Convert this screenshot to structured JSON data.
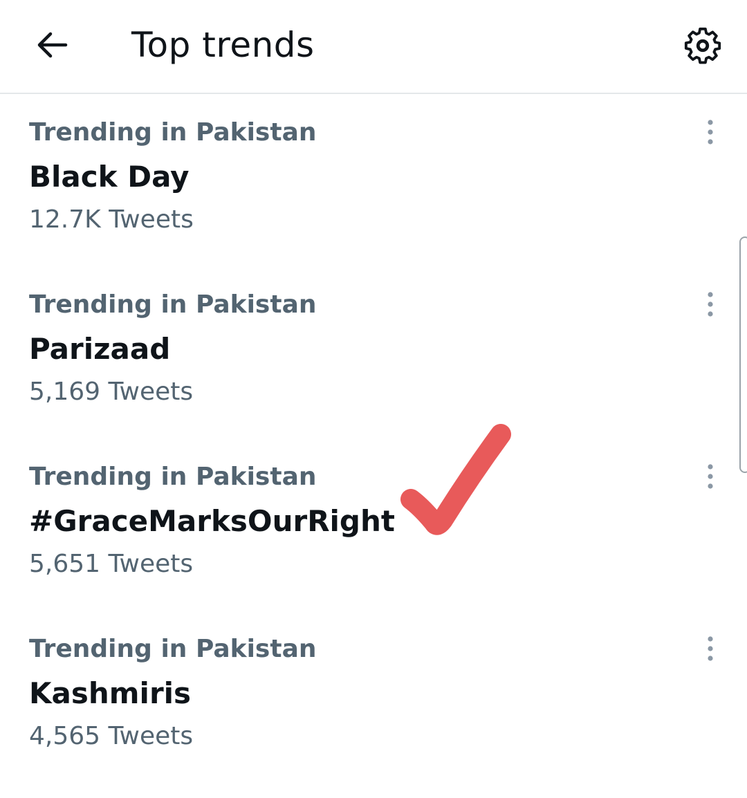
{
  "header": {
    "title": "Top trends",
    "back_icon": "arrow-left-icon",
    "settings_icon": "gear-icon"
  },
  "trends": [
    {
      "context": "Trending in Pakistan",
      "name": "Black Day",
      "count": "12.7K Tweets"
    },
    {
      "context": "Trending in Pakistan",
      "name": "Parizaad",
      "count": "5,169 Tweets"
    },
    {
      "context": "Trending in Pakistan",
      "name": "#GraceMarksOurRight",
      "count": "5,651 Tweets"
    },
    {
      "context": "Trending in Pakistan",
      "name": "Kashmiris",
      "count": "4,565 Tweets"
    }
  ],
  "annotation": {
    "icon": "red-checkmark",
    "color": "#e85a5a"
  },
  "colors": {
    "primary_text": "#0f1419",
    "secondary_text": "#536471",
    "divider": "#e4e8ea",
    "more_dots": "#8b98a5"
  }
}
